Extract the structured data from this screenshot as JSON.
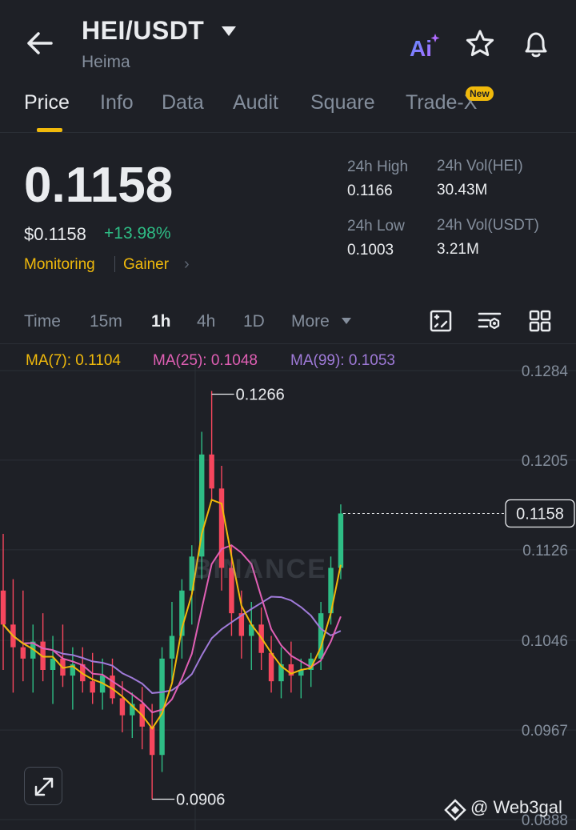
{
  "header": {
    "pair": "HEI/USDT",
    "name": "Heima",
    "ai_label": "Ai"
  },
  "tabs": [
    {
      "label": "Price",
      "active": true
    },
    {
      "label": "Info"
    },
    {
      "label": "Data"
    },
    {
      "label": "Audit"
    },
    {
      "label": "Square"
    },
    {
      "label": "Trade-X",
      "badge": "New"
    }
  ],
  "price": {
    "last": "0.1158",
    "usd": "$0.1158",
    "change": "+13.98%",
    "tags": [
      "Monitoring",
      "Gainer"
    ]
  },
  "stats": {
    "high_label": "24h High",
    "high_value": "0.1166",
    "low_label": "24h Low",
    "low_value": "0.1003",
    "vol_hei_label": "24h Vol(HEI)",
    "vol_hei_value": "30.43M",
    "vol_usdt_label": "24h Vol(USDT)",
    "vol_usdt_value": "3.21M"
  },
  "intervals": {
    "items": [
      "Time",
      "15m",
      "1h",
      "4h",
      "1D",
      "More"
    ],
    "active": "1h"
  },
  "chart_data": {
    "type": "candlestick",
    "ma_legend": {
      "ma7": "MA(7): 0.1104",
      "ma25": "MA(25): 0.1048",
      "ma99": "MA(99): 0.1053"
    },
    "y_ticks": [
      "0.1284",
      "0.1205",
      "0.1126",
      "0.1046",
      "0.0967",
      "0.0888"
    ],
    "ylim": [
      0.0888,
      0.1284
    ],
    "current_price_label": "0.1158",
    "high_label": "0.1266",
    "low_label": "0.0906",
    "watermark": "BINANCE",
    "candles": [
      [
        0.109,
        0.114,
        0.102,
        0.106
      ],
      [
        0.106,
        0.11,
        0.1,
        0.104
      ],
      [
        0.104,
        0.109,
        0.101,
        0.103
      ],
      [
        0.103,
        0.106,
        0.1,
        0.1045
      ],
      [
        0.1045,
        0.107,
        0.101,
        0.102
      ],
      [
        0.102,
        0.105,
        0.099,
        0.103
      ],
      [
        0.103,
        0.106,
        0.1005,
        0.1015
      ],
      [
        0.1015,
        0.104,
        0.0985,
        0.1025
      ],
      [
        0.1025,
        0.104,
        0.1,
        0.101
      ],
      [
        0.101,
        0.1035,
        0.099,
        0.1
      ],
      [
        0.1,
        0.103,
        0.0985,
        0.1015
      ],
      [
        0.1015,
        0.103,
        0.099,
        0.0995
      ],
      [
        0.0995,
        0.101,
        0.0965,
        0.098
      ],
      [
        0.098,
        0.1,
        0.096,
        0.099
      ],
      [
        0.099,
        0.1005,
        0.095,
        0.097
      ],
      [
        0.097,
        0.099,
        0.0906,
        0.0945
      ],
      [
        0.0945,
        0.104,
        0.093,
        0.103
      ],
      [
        0.103,
        0.108,
        0.101,
        0.105
      ],
      [
        0.105,
        0.11,
        0.103,
        0.109
      ],
      [
        0.109,
        0.113,
        0.106,
        0.112
      ],
      [
        0.112,
        0.123,
        0.11,
        0.121
      ],
      [
        0.121,
        0.1266,
        0.117,
        0.118
      ],
      [
        0.118,
        0.12,
        0.109,
        0.111
      ],
      [
        0.111,
        0.113,
        0.105,
        0.107
      ],
      [
        0.107,
        0.109,
        0.103,
        0.105
      ],
      [
        0.105,
        0.108,
        0.102,
        0.106
      ],
      [
        0.106,
        0.1075,
        0.102,
        0.1035
      ],
      [
        0.1035,
        0.105,
        0.1,
        0.101
      ],
      [
        0.101,
        0.104,
        0.0995,
        0.1025
      ],
      [
        0.1025,
        0.1045,
        0.1,
        0.1015
      ],
      [
        0.1015,
        0.103,
        0.0995,
        0.102
      ],
      [
        0.102,
        0.1035,
        0.1005,
        0.103
      ],
      [
        0.103,
        0.108,
        0.102,
        0.107
      ],
      [
        0.107,
        0.112,
        0.106,
        0.111
      ],
      [
        0.111,
        0.1166,
        0.11,
        0.1158
      ]
    ]
  },
  "credit": "@ Web3gal"
}
